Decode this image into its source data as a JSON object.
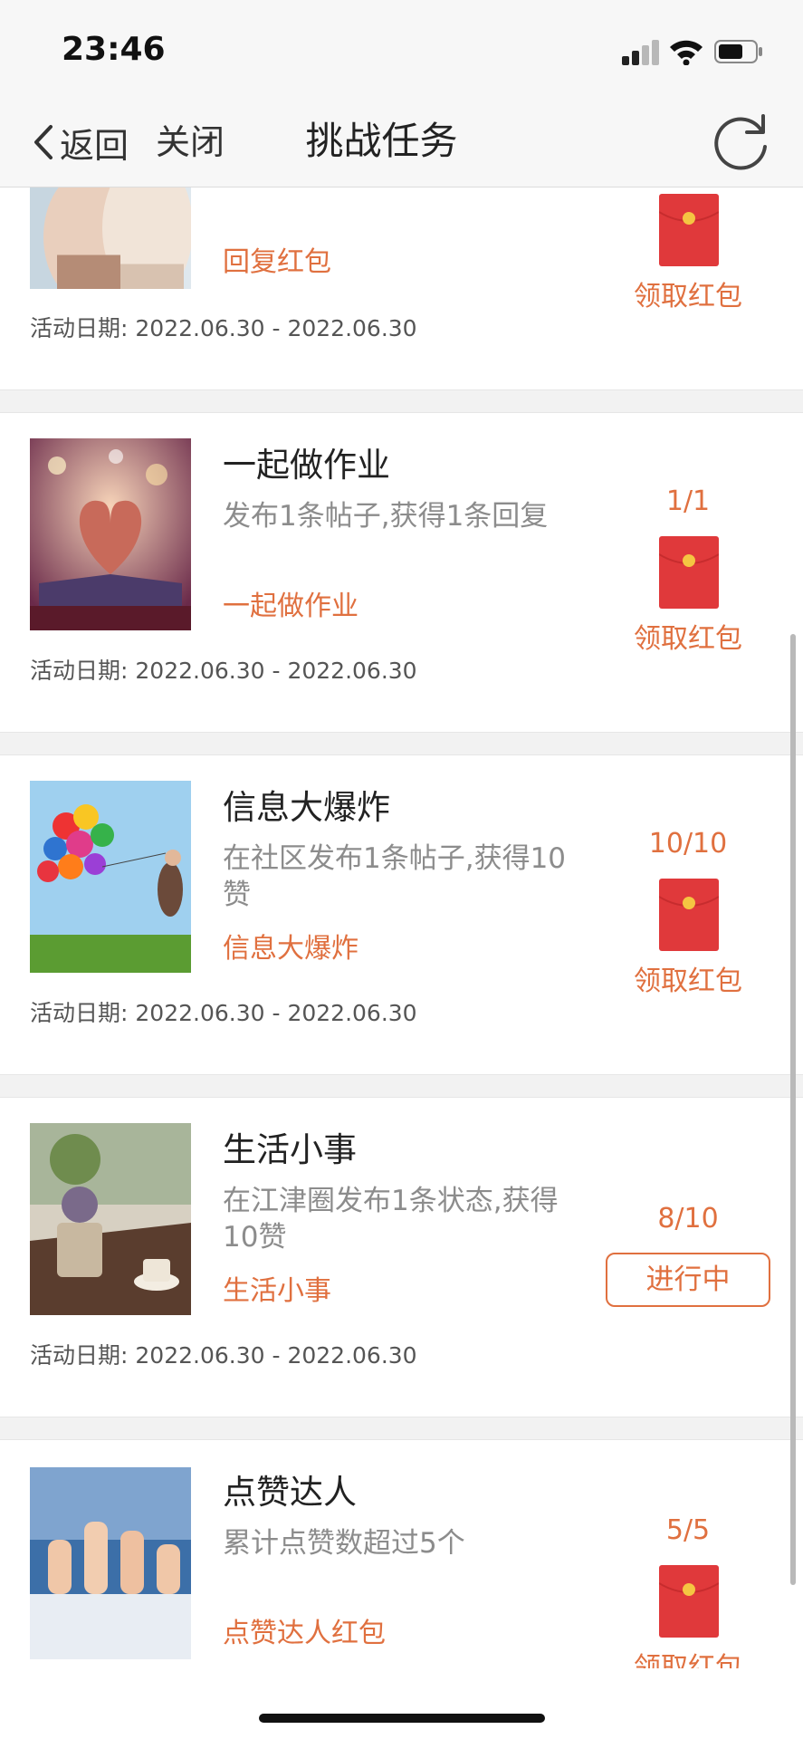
{
  "status_bar": {
    "time": "23:46"
  },
  "nav": {
    "back_label": "返回",
    "close_label": "关闭",
    "title": "挑战任务"
  },
  "colors": {
    "accent": "#e0703f",
    "envelope": "#e0393b",
    "separator": "#f2f2f2"
  },
  "tasks": [
    {
      "title": "",
      "description": "",
      "tag": "回复红包",
      "progress": "",
      "action": "领取红包",
      "date_label": "活动日期:",
      "date_range": "2022.06.30 - 2022.06.30",
      "thumb_icon": "people-photo"
    },
    {
      "title": "一起做作业",
      "description": "发布1条帖子,获得1条回复",
      "tag": "一起做作业",
      "progress": "1/1",
      "action": "领取红包",
      "date_label": "活动日期:",
      "date_range": "2022.06.30 - 2022.06.30",
      "thumb_icon": "heart-book-photo"
    },
    {
      "title": "信息大爆炸",
      "description": "在社区发布1条帖子,获得10赞",
      "tag": "信息大爆炸",
      "progress": "10/10",
      "action": "领取红包",
      "date_label": "活动日期:",
      "date_range": "2022.06.30 - 2022.06.30",
      "thumb_icon": "balloons-photo"
    },
    {
      "title": "生活小事",
      "description": "在江津圈发布1条状态,获得10赞",
      "tag": "生活小事",
      "progress": "8/10",
      "action": "进行中",
      "date_label": "活动日期:",
      "date_range": "2022.06.30 - 2022.06.30",
      "thumb_icon": "coffee-table-photo"
    },
    {
      "title": "点赞达人",
      "description": "累计点赞数超过5个",
      "tag": "点赞达人红包",
      "progress": "5/5",
      "action": "领取红包",
      "date_label": "",
      "date_range": "",
      "thumb_icon": "thumbs-up-photo"
    }
  ]
}
